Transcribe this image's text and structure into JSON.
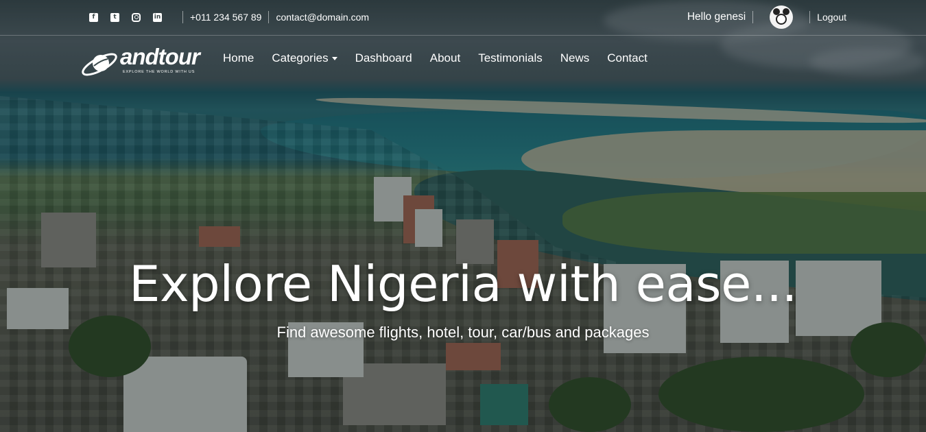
{
  "topbar": {
    "social": [
      {
        "icon": "facebook-icon",
        "glyph": "f"
      },
      {
        "icon": "twitter-icon",
        "glyph": "t"
      },
      {
        "icon": "instagram-icon",
        "glyph": ""
      },
      {
        "icon": "linkedin-icon",
        "glyph": "in"
      }
    ],
    "phone": "+011 234 567 89",
    "email": "contact@domain.com",
    "greeting": "Hello genesi",
    "logout_label": "Logout"
  },
  "brand": {
    "name": "andtour",
    "tagline": "EXPLORE THE WORLD WITH US"
  },
  "nav": {
    "items": [
      {
        "label": "Home"
      },
      {
        "label": "Categories",
        "dropdown": true
      },
      {
        "label": "Dashboard"
      },
      {
        "label": "About"
      },
      {
        "label": "Testimonials"
      },
      {
        "label": "News"
      },
      {
        "label": "Contact"
      }
    ]
  },
  "hero": {
    "title": "Explore Nigeria with ease...",
    "subtitle": "Find awesome flights, hotel, tour, car/bus and packages"
  },
  "colors": {
    "text": "#ffffff",
    "overlay": "#0f191c"
  }
}
